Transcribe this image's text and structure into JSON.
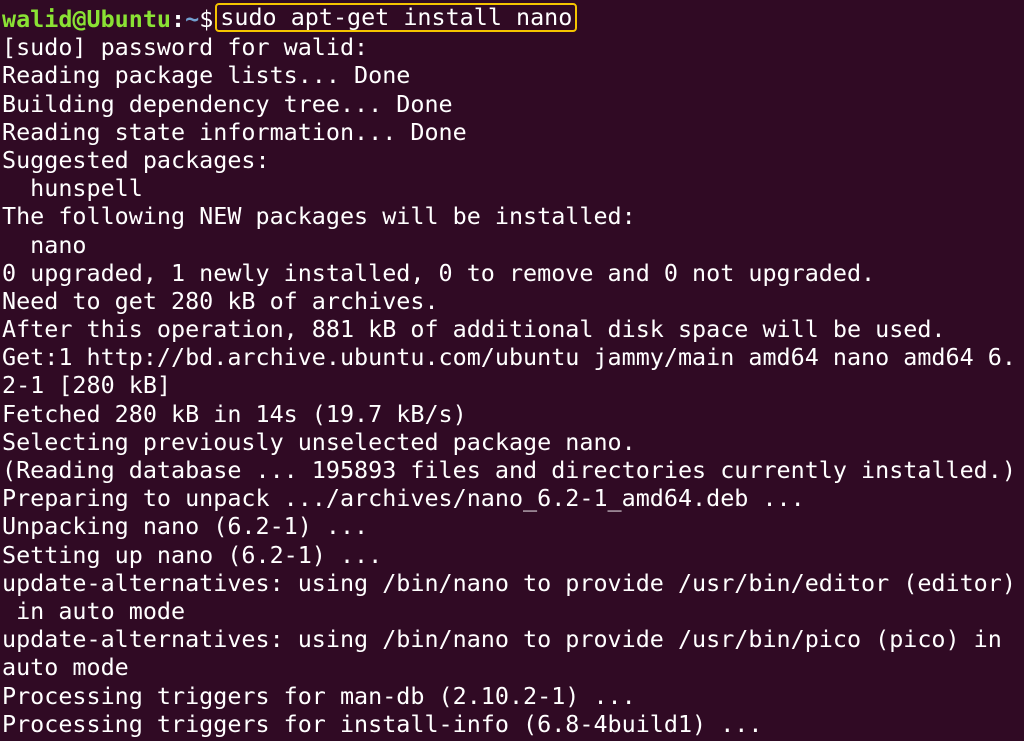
{
  "prompt": {
    "user_host": "walid@Ubuntu",
    "separator": ":",
    "path": "~",
    "symbol": "$",
    "command": "sudo apt-get install nano"
  },
  "output": [
    "[sudo] password for walid:",
    "Reading package lists... Done",
    "Building dependency tree... Done",
    "Reading state information... Done",
    "Suggested packages:",
    "  hunspell",
    "The following NEW packages will be installed:",
    "  nano",
    "0 upgraded, 1 newly installed, 0 to remove and 0 not upgraded.",
    "Need to get 280 kB of archives.",
    "After this operation, 881 kB of additional disk space will be used.",
    "Get:1 http://bd.archive.ubuntu.com/ubuntu jammy/main amd64 nano amd64 6.",
    "2-1 [280 kB]",
    "Fetched 280 kB in 14s (19.7 kB/s)",
    "Selecting previously unselected package nano.",
    "(Reading database ... 195893 files and directories currently installed.)",
    "Preparing to unpack .../archives/nano_6.2-1_amd64.deb ...",
    "Unpacking nano (6.2-1) ...",
    "Setting up nano (6.2-1) ...",
    "update-alternatives: using /bin/nano to provide /usr/bin/editor (editor)",
    " in auto mode",
    "update-alternatives: using /bin/nano to provide /usr/bin/pico (pico) in",
    "auto mode",
    "Processing triggers for man-db (2.10.2-1) ...",
    "Processing triggers for install-info (6.8-4build1) ..."
  ],
  "colors": {
    "background": "#300a24",
    "text": "#ffffff",
    "user_host": "#8ae234",
    "path": "#729fcf",
    "highlight_border": "#f5c400"
  }
}
